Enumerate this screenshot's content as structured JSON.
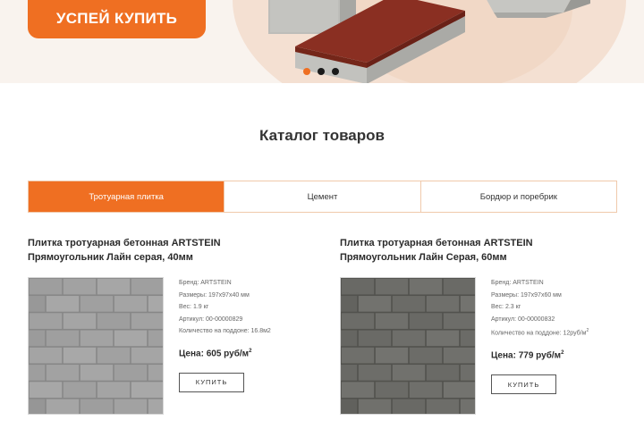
{
  "hero": {
    "cta_label": "УСПЕЙ КУПИТЬ",
    "slides": [
      true,
      false,
      false
    ],
    "colors": {
      "accent": "#ef6f22",
      "brick_red": "#8a2f22",
      "brick_gray": "#b8b8b4"
    }
  },
  "catalog": {
    "title": "Каталог товаров",
    "tabs": [
      "Тротуарная плитка",
      "Цемент",
      "Бордюр и поребрик"
    ],
    "active_tab": 0
  },
  "products": [
    {
      "title_line1": "Плитка тротуарная бетонная ARTSTEIN",
      "title_line2": "Прямоугольник Лайн серая, 40мм",
      "brand": "Бренд: ARTSTEIN",
      "size": "Размеры: 197x97x40 мм",
      "weight": "Вес: 1.9 кг",
      "sku": "Артикул: 00-00000829",
      "pallet": "Количество на поддоне: 16.8м2",
      "price_label": "Цена: 605 руб/м",
      "price_sup": "2",
      "buy_label": "КУПИТЬ",
      "tile_color": "#a3a3a3"
    },
    {
      "title_line1": "Плитка тротуарная бетонная ARTSTEIN",
      "title_line2": "Прямоугольник Лайн Серая, 60мм",
      "brand": "Бренд: ARTSTEIN",
      "size": "Размеры: 197x97x60 мм",
      "weight": "Вес: 2.3 кг",
      "sku": "Артикул: 00-00000832",
      "pallet": "Количество на поддоне: 12руб/м",
      "pallet_sup": "2",
      "price_label": "Цена: 779 руб/м",
      "price_sup": "2",
      "buy_label": "КУПИТЬ",
      "tile_color": "#6e6e6a"
    }
  ]
}
